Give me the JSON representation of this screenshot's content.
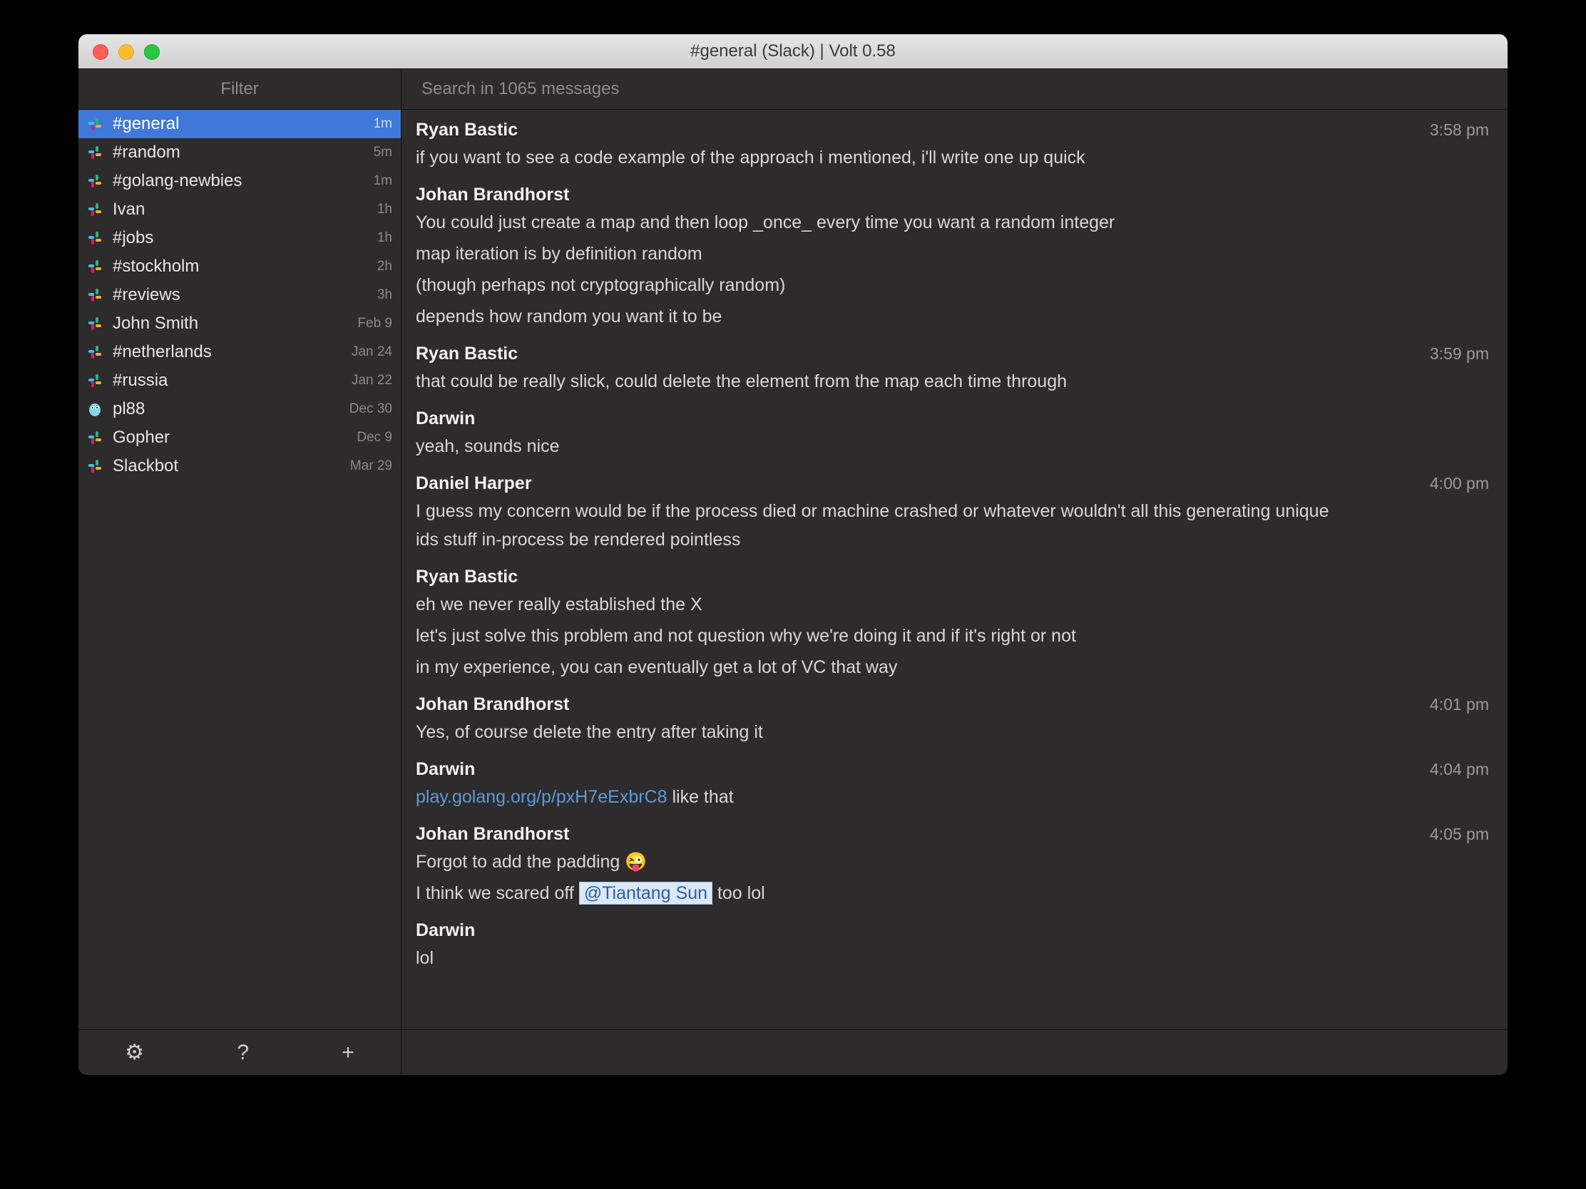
{
  "window": {
    "title": "#general (Slack)    |    Volt 0.58",
    "filter_placeholder": "Filter",
    "search_placeholder": "Search in 1065 messages"
  },
  "sidebar": {
    "items": [
      {
        "name": "#general",
        "time": "1m",
        "selected": true,
        "icon": "slack"
      },
      {
        "name": "#random",
        "time": "5m",
        "selected": false,
        "icon": "slack"
      },
      {
        "name": "#golang-newbies",
        "time": "1m",
        "selected": false,
        "icon": "slack"
      },
      {
        "name": "Ivan",
        "time": "1h",
        "selected": false,
        "icon": "slack"
      },
      {
        "name": "#jobs",
        "time": "1h",
        "selected": false,
        "icon": "slack"
      },
      {
        "name": "#stockholm",
        "time": "2h",
        "selected": false,
        "icon": "slack"
      },
      {
        "name": "#reviews",
        "time": "3h",
        "selected": false,
        "icon": "slack"
      },
      {
        "name": "John Smith",
        "time": "Feb 9",
        "selected": false,
        "icon": "slack"
      },
      {
        "name": "#netherlands",
        "time": "Jan 24",
        "selected": false,
        "icon": "slack"
      },
      {
        "name": "#russia",
        "time": "Jan 22",
        "selected": false,
        "icon": "slack"
      },
      {
        "name": "pl88",
        "time": "Dec 30",
        "selected": false,
        "icon": "gopher"
      },
      {
        "name": "Gopher",
        "time": "Dec 9",
        "selected": false,
        "icon": "slack"
      },
      {
        "name": "Slackbot",
        "time": "Mar 29",
        "selected": false,
        "icon": "slack"
      }
    ]
  },
  "messages": [
    {
      "author": "Ryan Bastic",
      "time": "3:58 pm",
      "lines": [
        {
          "text": "if you want to see a code example of the approach i mentioned, i'll write one up quick"
        }
      ]
    },
    {
      "author": "Johan Brandhorst",
      "time": "",
      "lines": [
        {
          "text": "You could just create a map and then loop _once_ every time you want a random integer"
        },
        {
          "text": "map iteration is by definition random"
        },
        {
          "text": "(though perhaps not cryptographically random)"
        },
        {
          "text": "depends how random you want it to be"
        }
      ]
    },
    {
      "author": "Ryan Bastic",
      "time": "3:59 pm",
      "lines": [
        {
          "text": "that could be really slick, could delete the element from the map each time through"
        }
      ]
    },
    {
      "author": "Darwin",
      "time": "",
      "lines": [
        {
          "text": "yeah, sounds nice"
        }
      ]
    },
    {
      "author": "Daniel Harper",
      "time": "4:00 pm",
      "lines": [
        {
          "text": "I guess my concern would be if the process died or machine crashed or whatever wouldn't all this generating unique ids stuff in-process be rendered pointless"
        }
      ]
    },
    {
      "author": "Ryan Bastic",
      "time": "",
      "lines": [
        {
          "text": "eh we never really established the X"
        },
        {
          "text": "let's just solve this problem and not question why we're doing it and if it's right or not"
        },
        {
          "text": "in my experience, you can eventually get a lot of VC that way"
        }
      ]
    },
    {
      "author": "Johan Brandhorst",
      "time": "4:01 pm",
      "lines": [
        {
          "text": "Yes, of course delete the entry after taking it"
        }
      ]
    },
    {
      "author": "Darwin",
      "time": "4:04 pm",
      "lines": [
        {
          "link": "play.golang.org/p/pxH7eExbrC8",
          "text_after": "  like that"
        }
      ]
    },
    {
      "author": "Johan Brandhorst",
      "time": "4:05 pm",
      "lines": [
        {
          "text": "Forgot to add the padding 😜"
        },
        {
          "text_before": "I think we scared off ",
          "mention": "@Tiantang Sun",
          "text_after": "   too lol"
        }
      ]
    },
    {
      "author": "Darwin",
      "time": "",
      "lines": [
        {
          "text": "lol"
        }
      ]
    }
  ],
  "footer": {
    "gear": "⚙",
    "help": "?",
    "plus": "+"
  }
}
